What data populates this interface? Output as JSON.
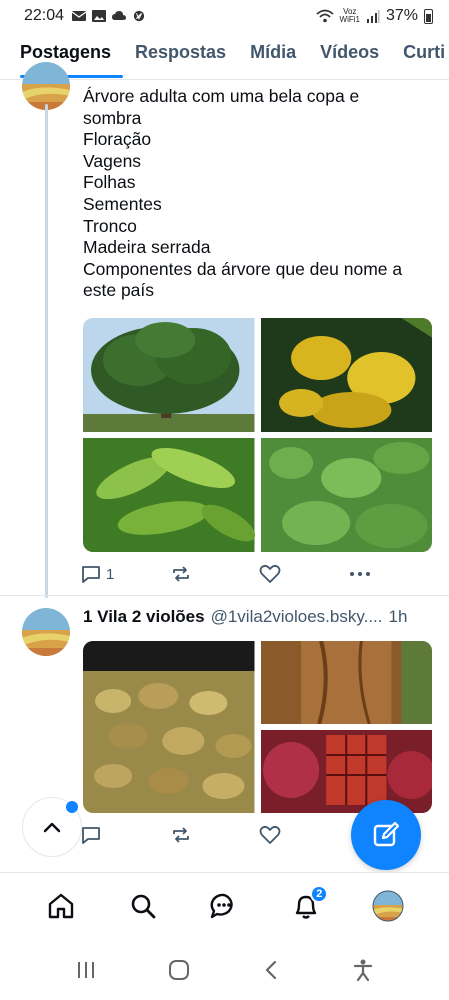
{
  "status_bar": {
    "time": "22:04",
    "network_label_top": "Voz",
    "network_label_bottom": "WiFi1",
    "battery": "37%"
  },
  "tabs": [
    {
      "label": "Postagens",
      "active": true
    },
    {
      "label": "Respostas",
      "active": false
    },
    {
      "label": "Mídia",
      "active": false
    },
    {
      "label": "Vídeos",
      "active": false
    },
    {
      "label": "Curti",
      "active": false
    }
  ],
  "post1": {
    "lines": [
      "Árvore adulta com uma bela copa e",
      "sombra",
      "Floração",
      "Vagens",
      "Folhas",
      "Sementes",
      "Tronco",
      "Madeira serrada",
      "Componentes da árvore que deu nome a",
      "este país"
    ],
    "images": [
      "tree-canopy-image",
      "yellow-flowers-image",
      "leaves-closeup-image",
      "small-leaves-image"
    ],
    "reply_count": "1"
  },
  "post2": {
    "author": "1 Vila 2 violões",
    "handle": "@1vila2violoes.bsky....",
    "time": "1h",
    "images": [
      "seeds-image",
      "trunk-bark-image",
      "sawn-wood-image"
    ]
  },
  "bottom_nav": {
    "notification_badge": "2"
  },
  "colors": {
    "accent": "#1083fe",
    "muted_text": "#42576c",
    "thread_line": "#c9d6e4"
  }
}
